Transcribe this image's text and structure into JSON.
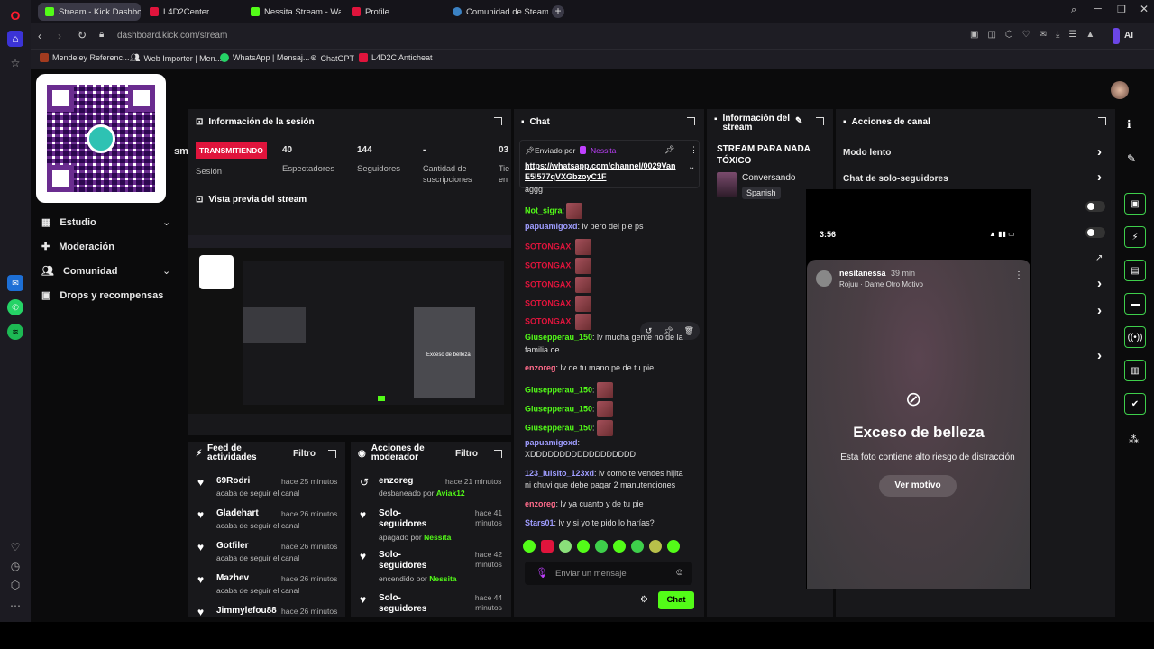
{
  "browser": {
    "tabs": [
      {
        "label": "Stream - Kick Dashboard",
        "color": "#53fc18"
      },
      {
        "label": "L4D2Center",
        "color": "#e0143c"
      },
      {
        "label": "Nessita Stream - Watch L",
        "color": "#53fc18"
      },
      {
        "label": "Profile",
        "color": "#e0143c"
      },
      {
        "label": "Comunidad de Steam :: N",
        "color": "#3b82c4"
      }
    ],
    "url": "dashboard.kick.com/stream",
    "ai_label": "AI",
    "bookmarks": [
      "Mendeley Referenc...",
      "Web Importer | Men...",
      "WhatsApp | Mensaj...",
      "ChatGPT",
      "L4D2C Anticheat"
    ]
  },
  "sidebar": {
    "items": [
      {
        "label": "Estudio",
        "chevron": true
      },
      {
        "label": "Moderación",
        "chevron": false
      },
      {
        "label": "Comunidad",
        "chevron": true
      },
      {
        "label": "Drops y recompensas",
        "chevron": false
      }
    ],
    "sm_fragment": "sm"
  },
  "session": {
    "title": "Información de la sesión",
    "badge": "TRANSMITIENDO",
    "badge_sub": "Sesión",
    "stats": [
      {
        "value": "40",
        "label": "Espectadores"
      },
      {
        "value": "144",
        "label": "Seguidores"
      },
      {
        "value": "-",
        "label": "Cantidad de suscripciones"
      },
      {
        "value": "03",
        "label": "Tie en"
      }
    ],
    "preview_title": "Vista previa del stream"
  },
  "chat": {
    "title": "Chat",
    "pinned_by": "Enviado por",
    "pinned_user": "Nessita",
    "pinned_link": "https://whatsapp.com/channel/0029VanE5I577qVXGbzoyC1F",
    "lines": [
      {
        "user": "",
        "text": "aggg",
        "color": "#ddd",
        "emotes": 0
      },
      {
        "user": "Not_sigra",
        "text": ":",
        "color": "#53fc18",
        "emotes": 1
      },
      {
        "user": "papuamigoxd",
        "text": ": lv pero del pie ps",
        "color": "#9f9dff",
        "emotes": 0
      },
      {
        "user": "SOTONGAX",
        "text": ":",
        "color": "#e0143c",
        "emotes": 1
      },
      {
        "user": "SOTONGAX",
        "text": ":",
        "color": "#e0143c",
        "emotes": 1
      },
      {
        "user": "SOTONGAX",
        "text": ":",
        "color": "#e0143c",
        "emotes": 1
      },
      {
        "user": "SOTONGAX",
        "text": ":",
        "color": "#e0143c",
        "emotes": 1
      },
      {
        "user": "SOTONGAX",
        "text": ":",
        "color": "#e0143c",
        "emotes": 1
      },
      {
        "user": "Giusepperau_150",
        "text": ": lv mucha gente no de la",
        "color": "#53fc18",
        "emotes": 0
      },
      {
        "user": "",
        "text": "familia oe",
        "color": "#ddd",
        "emotes": 0
      },
      {
        "user": "enzoreg",
        "text": ": lv de tu mano pe de tu pie",
        "color": "#ff6b8a",
        "emotes": 0
      },
      {
        "user": "Giusepperau_150",
        "text": ":",
        "color": "#53fc18",
        "emotes": 1
      },
      {
        "user": "Giusepperau_150",
        "text": ":",
        "color": "#53fc18",
        "emotes": 1
      },
      {
        "user": "Giusepperau_150",
        "text": ":",
        "color": "#53fc18",
        "emotes": 1
      },
      {
        "user": "papuamigoxd",
        "text": ":",
        "color": "#9f9dff",
        "emotes": 0
      },
      {
        "user": "",
        "text": "XDDDDDDDDDDDDDDDDDD",
        "color": "#ddd",
        "emotes": 0
      },
      {
        "user": "123_luisito_123xd",
        "text": ": lv como te vendes hijita",
        "color": "#9f9dff",
        "emotes": 0
      },
      {
        "user": "",
        "text": "ni chuvi que debe pagar 2 manutenciones",
        "color": "#ddd",
        "emotes": 0
      },
      {
        "user": "enzoreg",
        "text": ": lv ya cuanto y de tu pie",
        "color": "#ff6b8a",
        "emotes": 0
      },
      {
        "user": "Stars01",
        "text": ": lv y si yo te pido lo harías?",
        "color": "#9f9dff",
        "emotes": 0
      }
    ],
    "placeholder": "Enviar un mensaje",
    "send_label": "Chat"
  },
  "stream_info": {
    "title": "Información del stream",
    "stream_title": "STREAM PARA NADA TÓXICO",
    "category": "Conversando",
    "language": "Spanish"
  },
  "channel_actions": {
    "title": "Acciones de canal",
    "items": [
      "Modo lento",
      "Chat de solo-seguidores"
    ]
  },
  "phone": {
    "time": "3:56",
    "username": "nesitanessa",
    "ago": "39 min",
    "song": "Rojuu · Dame Otro Motivo",
    "warning_title": "Exceso de belleza",
    "warning_text": "Esta foto contiene alto riesgo de distracción",
    "button": "Ver motivo"
  },
  "activity": {
    "title": "Feed de actividades",
    "filter": "Filtro",
    "rows": [
      {
        "name": "69Rodri",
        "time": "hace 25 minutos",
        "sub": "acaba de seguir el canal"
      },
      {
        "name": "Gladehart",
        "time": "hace 26 minutos",
        "sub": "acaba de seguir el canal"
      },
      {
        "name": "Gotfiler",
        "time": "hace 26 minutos",
        "sub": "acaba de seguir el canal"
      },
      {
        "name": "Mazhev",
        "time": "hace 26 minutos",
        "sub": "acaba de seguir el canal"
      },
      {
        "name": "Jimmylefou88",
        "time": "hace 26 minutos",
        "sub": ""
      }
    ]
  },
  "mod_actions": {
    "title": "Acciones de moderador",
    "filter": "Filtro",
    "rows": [
      {
        "name": "enzoreg",
        "time": "hace 21 minutos",
        "sub": "desbaneado por",
        "by": "Aviak12"
      },
      {
        "name": "Solo-seguidores",
        "time": "hace 41 minutos",
        "sub": "apagado por",
        "by": "Nessita"
      },
      {
        "name": "Solo-seguidores",
        "time": "hace 42 minutos",
        "sub": "encendido por",
        "by": "Nessita"
      },
      {
        "name": "Solo-seguidores",
        "time": "hace 44 minutos",
        "sub": "",
        "by": ""
      }
    ]
  }
}
